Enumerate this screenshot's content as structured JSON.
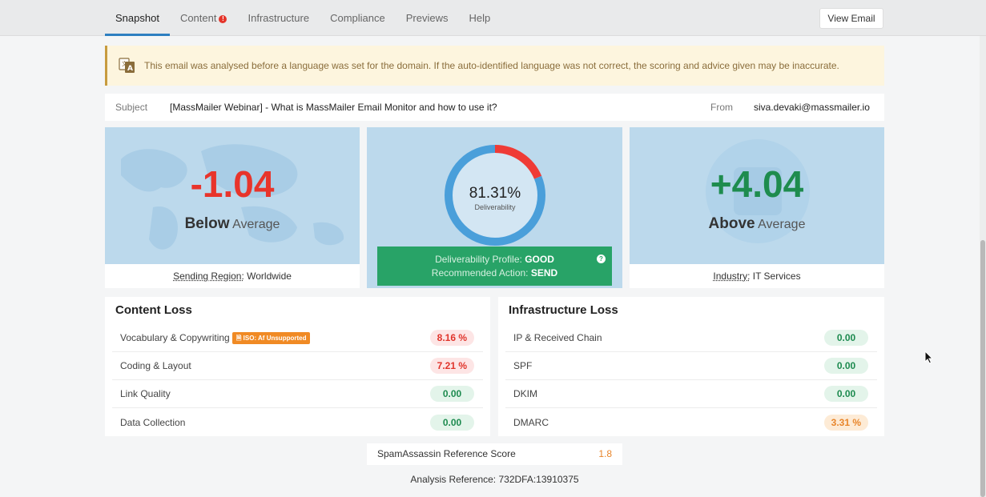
{
  "tabs": [
    {
      "label": "Snapshot",
      "active": true
    },
    {
      "label": "Content",
      "alert": true
    },
    {
      "label": "Infrastructure"
    },
    {
      "label": "Compliance"
    },
    {
      "label": "Previews"
    },
    {
      "label": "Help"
    }
  ],
  "alert_glyph": "!",
  "view_email_label": "View Email",
  "notice": {
    "icon": "language-icon",
    "text": "This email was analysed before a language was set for the domain. If the auto-identified language was not correct, the scoring and advice given may be inaccurate."
  },
  "email": {
    "subject_label": "Subject",
    "subject_value": "[MassMailer Webinar] - What is MassMailer Email Monitor and how to use it?",
    "from_label": "From",
    "from_value": "siva.devaki@massmailer.io"
  },
  "region_card": {
    "score": "-1.04",
    "score_color": "#e8342b",
    "comparison_bold": "Below",
    "comparison_rest": " Average",
    "footer_label": "Sending Region:",
    "footer_value": " Worldwide"
  },
  "deliverability_card": {
    "percent": 81.31,
    "percent_text": "81.31%",
    "label": "Deliverability",
    "colors": {
      "good": "#4a9fda",
      "bad": "#ef3b36"
    },
    "profile_label": "Deliverability Profile:",
    "profile_value": "GOOD",
    "action_label": "Recommended Action:",
    "action_value": "SEND",
    "help_glyph": "?"
  },
  "industry_card": {
    "score": "+4.04",
    "score_color": "#1e8c4e",
    "comparison_bold": "Above",
    "comparison_rest": " Average",
    "footer_label": "Industry:",
    "footer_value": " IT Services"
  },
  "content_loss": {
    "title": "Content Loss",
    "rows": [
      {
        "name": "Vocabulary & Copywriting",
        "value": "8.16 %",
        "status": "red",
        "tag": "ISO: Af  Unsupported"
      },
      {
        "name": "Coding & Layout",
        "value": "7.21 %",
        "status": "red"
      },
      {
        "name": "Link Quality",
        "value": "0.00",
        "status": "green"
      },
      {
        "name": "Data Collection",
        "value": "0.00",
        "status": "green"
      }
    ]
  },
  "infrastructure_loss": {
    "title": "Infrastructure Loss",
    "rows": [
      {
        "name": "IP & Received Chain",
        "value": "0.00",
        "status": "green"
      },
      {
        "name": "SPF",
        "value": "0.00",
        "status": "green"
      },
      {
        "name": "DKIM",
        "value": "0.00",
        "status": "green"
      },
      {
        "name": "DMARC",
        "value": "3.31 %",
        "status": "orange"
      }
    ]
  },
  "spamassassin": {
    "label": "SpamAssassin Reference Score",
    "value": "1.8"
  },
  "analysis_reference": "Analysis Reference: 732DFA:13910375"
}
